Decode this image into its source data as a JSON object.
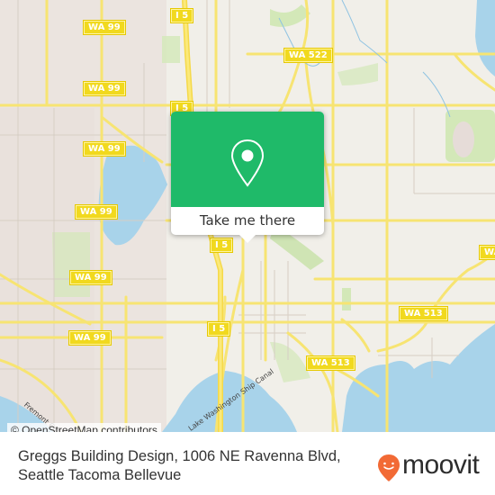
{
  "map": {
    "attribution": "© OpenStreetMap contributors",
    "colors": {
      "land": "#f1efe9",
      "water": "#a8d3ea",
      "park": "#d3e8b8",
      "road_major": "#f7e472",
      "road_minor": "#d9d3c8",
      "shield": "#f1d91e"
    },
    "shields": [
      {
        "label": "WA 99"
      },
      {
        "label": "WA 99"
      },
      {
        "label": "WA 99"
      },
      {
        "label": "WA 99"
      },
      {
        "label": "WA 99"
      },
      {
        "label": "WA 99"
      },
      {
        "label": "WA 99"
      },
      {
        "label": "I 5"
      },
      {
        "label": "I 5"
      },
      {
        "label": "I 5"
      },
      {
        "label": "I 5"
      },
      {
        "label": "WA 522"
      },
      {
        "label": "WA 513"
      },
      {
        "label": "WA 513"
      },
      {
        "label": "WA 513"
      }
    ],
    "water_labels": [
      "Lake Washington Ship Canal",
      "Fremont Cut"
    ]
  },
  "popup": {
    "button_label": "Take me there",
    "accent_color": "#1fba69",
    "icon": "map-pin-icon"
  },
  "footer": {
    "address_line": "Greggs Building Design, 1006 NE Ravenna Blvd, Seattle Tacoma Bellevue",
    "brand": "moovit",
    "brand_color": "#f26a35"
  }
}
